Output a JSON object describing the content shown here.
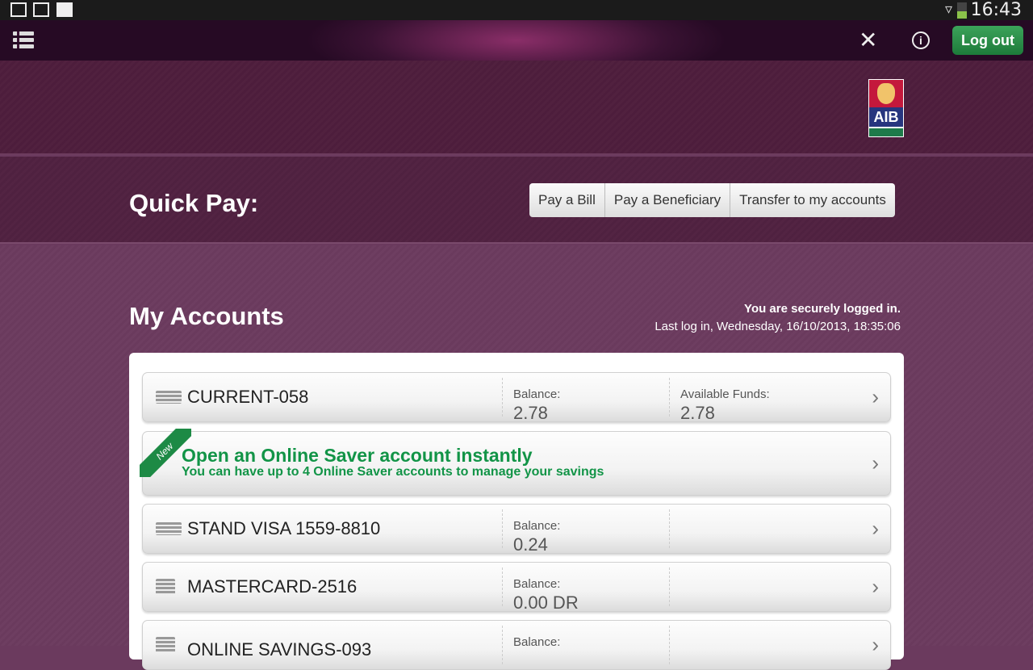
{
  "status_bar": {
    "time": "16:43"
  },
  "top_bar": {
    "logout_label": "Log out"
  },
  "header": {
    "logo_text": "AIB"
  },
  "quick_pay": {
    "title": "Quick Pay:",
    "buttons": [
      "Pay a Bill",
      "Pay a Beneficiary",
      "Transfer to my accounts"
    ]
  },
  "accounts": {
    "title": "My Accounts",
    "secure_text": "You are securely logged in.",
    "last_login": "Last log in, Wednesday, 16/10/2013, 18:35:06",
    "rows": [
      {
        "name": "CURRENT-058",
        "balance_label": "Balance:",
        "balance": "2.78",
        "available_label": "Available Funds:",
        "available": "2.78"
      },
      {
        "name": "STAND VISA 1559-8810",
        "balance_label": "Balance:",
        "balance": "0.24"
      },
      {
        "name": "MASTERCARD-2516",
        "balance_label": "Balance:",
        "balance": "0.00 DR"
      },
      {
        "name": "ONLINE SAVINGS-093",
        "balance_label": "Balance:"
      }
    ],
    "promo": {
      "badge": "New",
      "title": "Open an Online Saver account instantly",
      "subtitle": "You can have up to 4 Online Saver accounts to manage your savings"
    }
  }
}
